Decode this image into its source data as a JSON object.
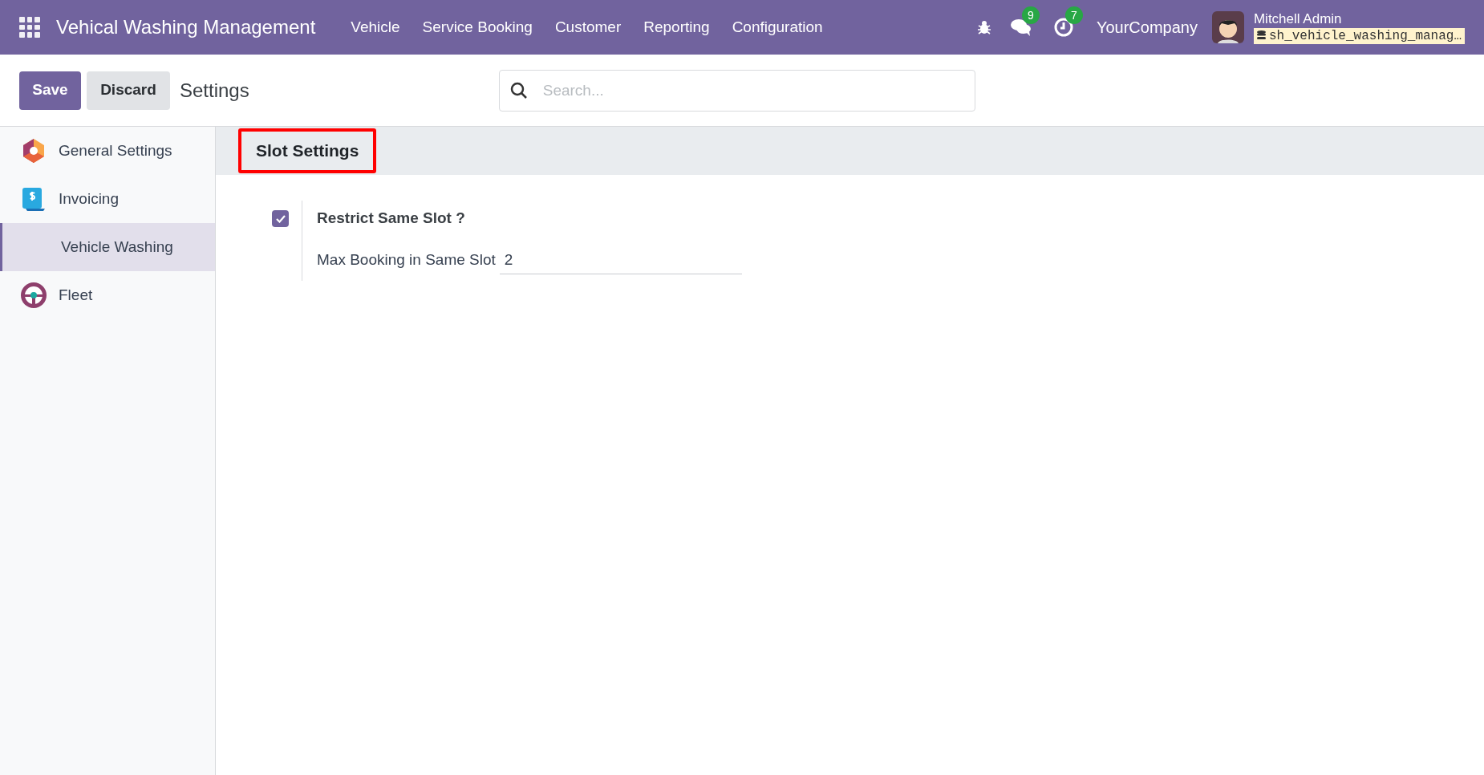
{
  "navbar": {
    "app_title": "Vehical Washing Management",
    "menu": [
      "Vehicle",
      "Service Booking",
      "Customer",
      "Reporting",
      "Configuration"
    ],
    "messages_count": "9",
    "activities_count": "7",
    "company": "YourCompany",
    "user_name": "Mitchell Admin",
    "database": "sh_vehicle_washing_manag…"
  },
  "control_panel": {
    "save": "Save",
    "discard": "Discard",
    "breadcrumb": "Settings",
    "search": {
      "placeholder": "Search..."
    }
  },
  "sidebar": {
    "items": [
      {
        "kind": "general",
        "label": "General Settings",
        "selected": false
      },
      {
        "kind": "invoicing",
        "label": "Invoicing",
        "selected": false
      },
      {
        "kind": "none",
        "label": "Vehicle Washing",
        "selected": true
      },
      {
        "kind": "fleet",
        "label": "Fleet",
        "selected": false
      }
    ]
  },
  "section": {
    "title": "Slot Settings",
    "highlighted": true,
    "settings": [
      {
        "label": "Restrict Same Slot ?",
        "checked": true,
        "field_label": "Max Booking in Same Slot",
        "field_value": "2"
      }
    ]
  }
}
